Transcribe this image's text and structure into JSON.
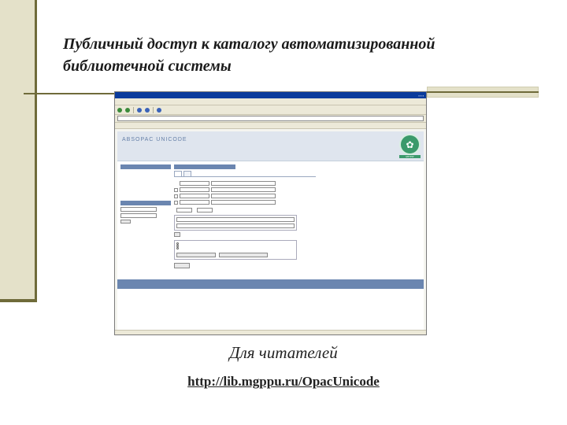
{
  "slide": {
    "title": "Публичный доступ к  каталогу автоматизированной библиотечной системы",
    "caption": "Для читателей",
    "url": "http://lib.mgppu.ru/OpacUnicode"
  },
  "opac": {
    "logo": "ABSOPAC UNICODE",
    "emblem_label": "МГППУ"
  }
}
